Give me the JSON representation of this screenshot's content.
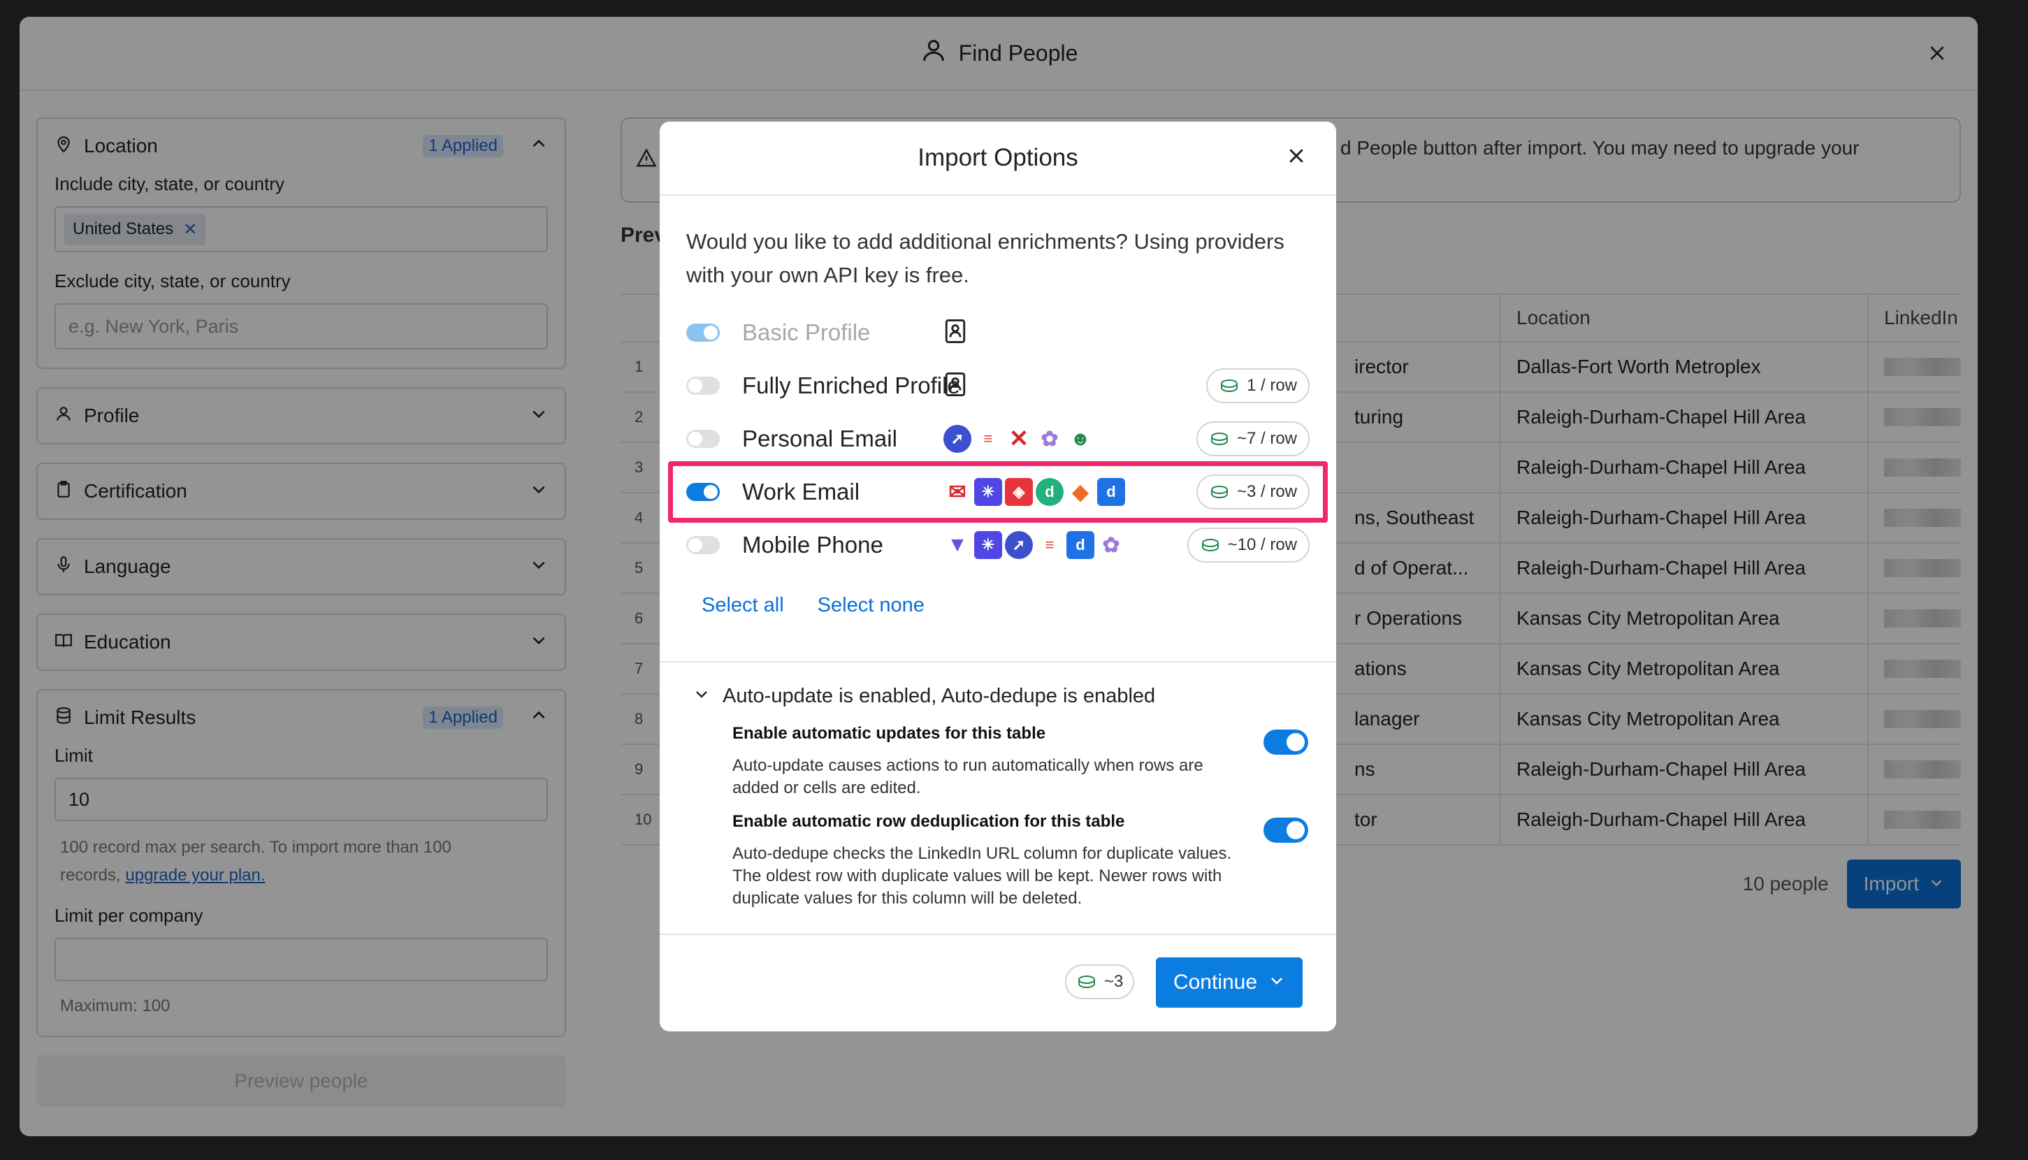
{
  "window": {
    "title": "Find People"
  },
  "sidebar": {
    "location": {
      "label": "Location",
      "badge": "1 Applied",
      "include_label": "Include city, state, or country",
      "include_chip": "United States",
      "exclude_label": "Exclude city, state, or country",
      "exclude_placeholder": "e.g. New York, Paris"
    },
    "profile": "Profile",
    "certification": "Certification",
    "language": "Language",
    "education": "Education",
    "limit": {
      "label": "Limit Results",
      "badge": "1 Applied",
      "limit_label": "Limit",
      "limit_value": "10",
      "help_1": "100 record max per search. To import more than 100",
      "help_2": "records,",
      "help_link": "upgrade your plan.",
      "per_company_label": "Limit per company",
      "per_company_value": "",
      "maximum": "Maximum: 100"
    },
    "preview_button": "Preview people"
  },
  "main": {
    "warning": "d People button after import. You may need to upgrade your",
    "preview_label": "Prev",
    "columns": [
      "Location",
      "LinkedIn UR"
    ],
    "rows": [
      {
        "num": "1",
        "role": "irector",
        "location": "Dallas-Fort Worth Metroplex"
      },
      {
        "num": "2",
        "role": "turing",
        "location": "Raleigh-Durham-Chapel Hill Area"
      },
      {
        "num": "3",
        "role": "",
        "location": "Raleigh-Durham-Chapel Hill Area"
      },
      {
        "num": "4",
        "role": "ns, Southeast",
        "location": "Raleigh-Durham-Chapel Hill Area"
      },
      {
        "num": "5",
        "role": "d of Operat...",
        "location": "Raleigh-Durham-Chapel Hill Area"
      },
      {
        "num": "6",
        "role": "r Operations",
        "location": "Kansas City Metropolitan Area"
      },
      {
        "num": "7",
        "role": "ations",
        "location": "Kansas City Metropolitan Area"
      },
      {
        "num": "8",
        "role": "lanager",
        "location": "Kansas City Metropolitan Area"
      },
      {
        "num": "9",
        "role": "ns",
        "location": "Raleigh-Durham-Chapel Hill Area"
      },
      {
        "num": "10",
        "role": "tor",
        "location": "Raleigh-Durham-Chapel Hill Area"
      }
    ],
    "people_count": "10 people",
    "import_button": "Import"
  },
  "modal": {
    "title": "Import Options",
    "question": "Would you like to add additional enrichments? Using providers with your own API key is free.",
    "options": [
      {
        "label": "Basic Profile",
        "enabled": true,
        "disabled": true,
        "cost": ""
      },
      {
        "label": "Fully Enriched Profile",
        "enabled": false,
        "cost": "1 / row"
      },
      {
        "label": "Personal Email",
        "enabled": false,
        "cost": "~7 / row"
      },
      {
        "label": "Work Email",
        "enabled": true,
        "cost": "~3 / row"
      },
      {
        "label": "Mobile Phone",
        "enabled": false,
        "cost": "~10 / row"
      }
    ],
    "select_all": "Select all",
    "select_none": "Select none",
    "auto_header": "Auto-update is enabled, Auto-dedupe is enabled",
    "auto_update_title": "Enable automatic updates for this table",
    "auto_update_desc": "Auto-update causes actions to run automatically when rows are added or cells are edited.",
    "dedupe_title": "Enable automatic row deduplication for this table",
    "dedupe_desc": "Auto-dedupe checks the LinkedIn URL column for duplicate values. The oldest row with duplicate values will be kept. Newer rows with duplicate values for this column will be deleted.",
    "total_cost": "~3",
    "continue_button": "Continue"
  },
  "colors": {
    "accent": "#0b7de0",
    "highlight": "#f0286e"
  }
}
